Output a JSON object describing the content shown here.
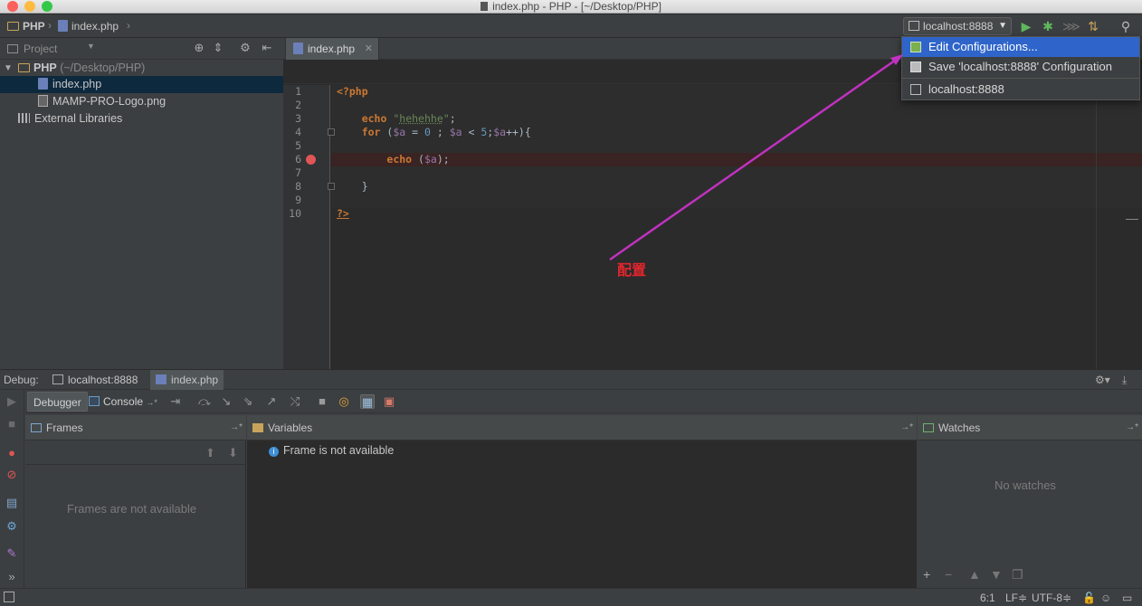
{
  "window": {
    "title": "index.php - PHP - [~/Desktop/PHP]"
  },
  "navbar": {
    "crumb_project": "PHP",
    "crumb_file": "index.php",
    "run_config": "localhost:8888"
  },
  "run_menu": {
    "items": [
      {
        "label": "Edit Configurations..."
      },
      {
        "label": "Save 'localhost:8888' Configuration"
      },
      {
        "label": "localhost:8888"
      }
    ]
  },
  "project": {
    "header": "Project",
    "tree": [
      {
        "label": "PHP",
        "path": "(~/Desktop/PHP)"
      },
      {
        "label": "index.php"
      },
      {
        "label": "MAMP-PRO-Logo.png"
      },
      {
        "label": "External Libraries"
      }
    ]
  },
  "editor": {
    "tab": "index.php",
    "line_numbers": [
      "1",
      "2",
      "3",
      "4",
      "5",
      "6",
      "7",
      "8",
      "9",
      "10"
    ]
  },
  "annotation": {
    "text": "配置",
    "color": "#e0262d"
  },
  "debug": {
    "label": "Debug:",
    "tabs": [
      "localhost:8888",
      "index.php"
    ],
    "toolbar_tabs": [
      "Debugger",
      "Console"
    ],
    "frames_title": "Frames",
    "frames_empty": "Frames are not available",
    "variables_title": "Variables",
    "variables_msg": "Frame is not available",
    "watches_title": "Watches",
    "watches_empty": "No watches"
  },
  "status": {
    "position": "6:1",
    "line_sep": "LF≑",
    "encoding": "UTF-8≑"
  },
  "colors": {
    "selection": "#2f65ca",
    "breakpoint": "#e05555",
    "keyword": "#cc7832",
    "string": "#6a8759",
    "variable": "#9876aa",
    "number": "#6897bb"
  }
}
